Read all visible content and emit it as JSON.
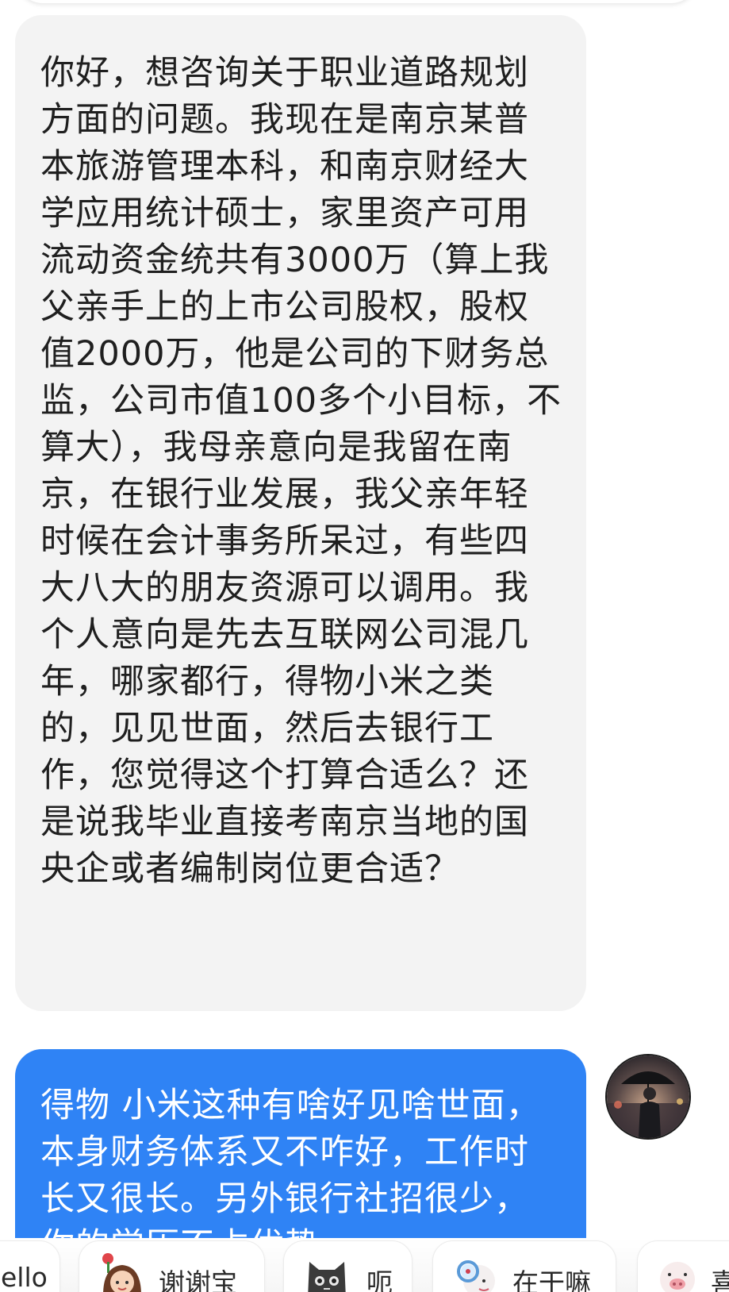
{
  "messages": [
    {
      "direction": "incoming",
      "text": "你好，想咨询关于职业道路规划方面的问题。我现在是南京某普本旅游管理本科，和南京财经大学应用统计硕士，家里资产可用流动资金统共有3000万（算上我父亲手上的上市公司股权，股权值2000万，他是公司的下财务总监，公司市值100多个小目标，不算大），我母亲意向是我留在南京，在银行业发展，我父亲年轻时候在会计事务所呆过，有些四大八大的朋友资源可以调用。我个人意向是先去互联网公司混几年，哪家都行，得物小米之类的，见见世面，然后去银行工作，您觉得这个打算合适么？还是说我毕业直接考南京当地的国央企或者编制岗位更合适？"
    },
    {
      "direction": "outgoing",
      "text": "得物 小米这种有啥好见啥世面，本身财务体系又不咋好，工作时长又很长。另外银行社招很少，你的学历不占优势"
    }
  ],
  "avatar": {
    "icon": "person-with-umbrella-avatar"
  },
  "quick_replies": [
    {
      "label": "ello",
      "sticker": ""
    },
    {
      "label": "谢谢宝",
      "sticker": "flower-girl-sticker"
    },
    {
      "label": "呃",
      "sticker": "cat-sticker"
    },
    {
      "label": "在干嘛",
      "sticker": "magnifier-sheep-sticker"
    },
    {
      "label": "喜",
      "sticker": "pig-sticker"
    }
  ],
  "colors": {
    "incoming_bubble": "#f3f3f3",
    "outgoing_bubble": "#2f83f5",
    "incoming_text": "#1f1f1f",
    "outgoing_text": "#ffffff"
  }
}
